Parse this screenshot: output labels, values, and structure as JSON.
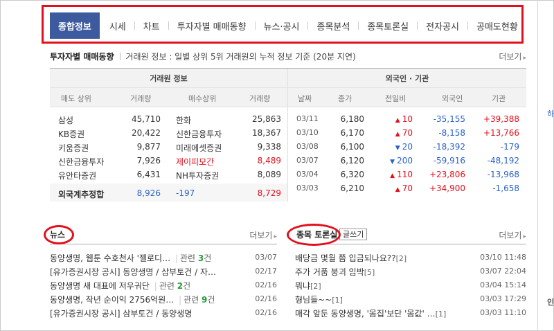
{
  "tabs": [
    "종합정보",
    "시세",
    "차트",
    "투자자별 매매동향",
    "뉴스·공시",
    "종목분석",
    "종목토론실",
    "전자공시",
    "공매도현황"
  ],
  "investor": {
    "title": "투자자별 매매동향",
    "desc": "거래원 정보 : 일별 상위 5위 거래원의 누적 정보 기준 (20분 지연)",
    "more": "더보기",
    "broker_group": "거래원 정보",
    "foreign_group": "외국인 · 기관",
    "broker_headers": [
      "매도 상위",
      "거래량",
      "매수상위",
      "거래량"
    ],
    "foreign_headers": [
      "날짜",
      "종가",
      "전일비",
      "외국인",
      "기관"
    ],
    "broker_rows": [
      {
        "sell": "삼성",
        "sell_vol": "45,710",
        "buy": "한화",
        "buy_vol": "25,863",
        "buy_red": false
      },
      {
        "sell": "KB증권",
        "sell_vol": "20,422",
        "buy": "신한금융투자",
        "buy_vol": "18,367",
        "buy_red": false
      },
      {
        "sell": "키움증권",
        "sell_vol": "9,877",
        "buy": "미래에셋증권",
        "buy_vol": "9,338",
        "buy_red": false
      },
      {
        "sell": "신한금융투자",
        "sell_vol": "7,926",
        "buy": "제이피모간",
        "buy_vol": "8,489",
        "buy_red": true
      },
      {
        "sell": "유안타증권",
        "sell_vol": "6,431",
        "buy": "NH투자증권",
        "buy_vol": "8,089",
        "buy_red": false
      }
    ],
    "foreign_total": {
      "label": "외국계추정합",
      "sell": "8,926",
      "net": "-197",
      "buy": "8,729"
    },
    "foreign_rows": [
      {
        "date": "03/11",
        "close": "6,180",
        "dir": "up",
        "chg": "10",
        "foreign": "-35,155",
        "inst": "+39,388"
      },
      {
        "date": "03/10",
        "close": "6,170",
        "dir": "up",
        "chg": "70",
        "foreign": "-8,158",
        "inst": "+13,766"
      },
      {
        "date": "03/08",
        "close": "6,100",
        "dir": "down",
        "chg": "20",
        "foreign": "-18,392",
        "inst": "-179"
      },
      {
        "date": "03/07",
        "close": "6,120",
        "dir": "down",
        "chg": "200",
        "foreign": "-59,916",
        "inst": "-48,192"
      },
      {
        "date": "03/04",
        "close": "6,320",
        "dir": "up",
        "chg": "110",
        "foreign": "+23,806",
        "inst": "-13,968"
      },
      {
        "date": "03/03",
        "close": "6,210",
        "dir": "up",
        "chg": "70",
        "foreign": "+34,900",
        "inst": "-1,658"
      }
    ]
  },
  "news": {
    "title": "뉴스",
    "more": "더보기",
    "items": [
      {
        "text": "동양생명, 웹툰 수호천사 '젤로디…",
        "related": "관련 ",
        "count": "3",
        "unit": "건",
        "date": "03/07"
      },
      {
        "text": "[유가증권시장 공시] 동양생명 / 삼부토건 / 자…",
        "related": "",
        "count": "",
        "unit": "",
        "date": "02/17"
      },
      {
        "text": "동양생명 새 대표에 저우궈단",
        "related": "관련 ",
        "count": "2",
        "unit": "건",
        "date": "02/16"
      },
      {
        "text": "동양생명, 작년 순이익 2756억원…",
        "related": "관련 ",
        "count": "9",
        "unit": "건",
        "date": "02/16"
      },
      {
        "text": "[유가증권시장 공시] 삼부토건 / 동양생명",
        "related": "",
        "count": "",
        "unit": "",
        "date": "02/16"
      }
    ]
  },
  "board": {
    "title": "종목 토론실",
    "write": "글쓰기",
    "more": "더보기",
    "items": [
      {
        "text": "배당금 몇월 쯤 입금되나요??",
        "comments": "[2]",
        "date": "03/10 11:48"
      },
      {
        "text": "주가 거품 붕괴 임박",
        "comments": "[5]",
        "date": "03/07 22:04"
      },
      {
        "text": "뭐냐",
        "comments": "[2]",
        "date": "03/04 15:14"
      },
      {
        "text": "형님들~~",
        "comments": "[1]",
        "date": "03/03 17:29"
      },
      {
        "text": "매각 앞둔 동양생명, '몸집'보단 '몸값' …",
        "comments": "[1]",
        "date": "03/03 11:10"
      }
    ]
  },
  "edge": {
    "char1": "하",
    "char2": "인"
  }
}
